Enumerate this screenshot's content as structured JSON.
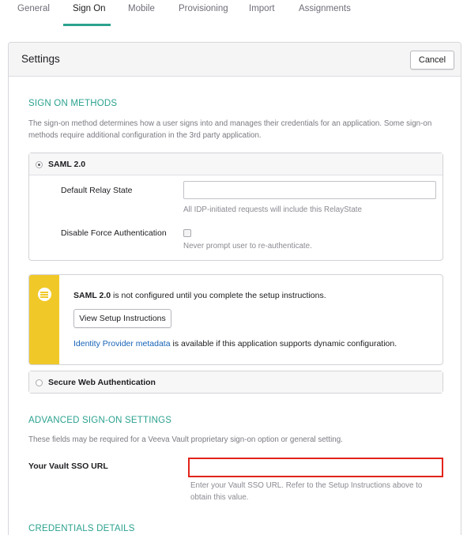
{
  "tabs": [
    {
      "label": "General"
    },
    {
      "label": "Sign On"
    },
    {
      "label": "Mobile"
    },
    {
      "label": "Provisioning"
    },
    {
      "label": "Import"
    },
    {
      "label": "Assignments"
    }
  ],
  "active_tab": "Sign On",
  "settings": {
    "title": "Settings",
    "cancel_label": "Cancel"
  },
  "sign_on_methods": {
    "title": "SIGN ON METHODS",
    "description": "The sign-on method determines how a user signs into and manages their credentials for an application. Some sign-on methods require additional configuration in the 3rd party application.",
    "saml": {
      "label": "SAML 2.0",
      "selected": true,
      "relay_state_label": "Default Relay State",
      "relay_state_value": "",
      "relay_state_help": "All IDP-initiated requests will include this RelayState",
      "force_auth_label": "Disable Force Authentication",
      "force_auth_checked": false,
      "force_auth_help": "Never prompt user to re-authenticate."
    },
    "notice": {
      "icon": "list-icon",
      "line1_bold": "SAML 2.0",
      "line1_rest": " is not configured until you complete the setup instructions.",
      "button_label": "View Setup Instructions",
      "metadata_link": "Identity Provider metadata",
      "metadata_rest": " is available if this application supports dynamic configuration."
    },
    "swa": {
      "label": "Secure Web Authentication",
      "selected": false
    }
  },
  "advanced": {
    "title": "ADVANCED SIGN-ON SETTINGS",
    "description": "These fields may be required for a Veeva Vault proprietary sign-on option or general setting.",
    "sso_url_label": "Your Vault SSO URL",
    "sso_url_value": "",
    "sso_url_help": "Enter your Vault SSO URL. Refer to the Setup Instructions above to obtain this value."
  },
  "credentials": {
    "title": "CREDENTIALS DETAILS"
  },
  "colors": {
    "accent": "#2ba28f",
    "notice_bar": "#f0c929",
    "highlight": "#e2231a",
    "link": "#1662b6"
  }
}
